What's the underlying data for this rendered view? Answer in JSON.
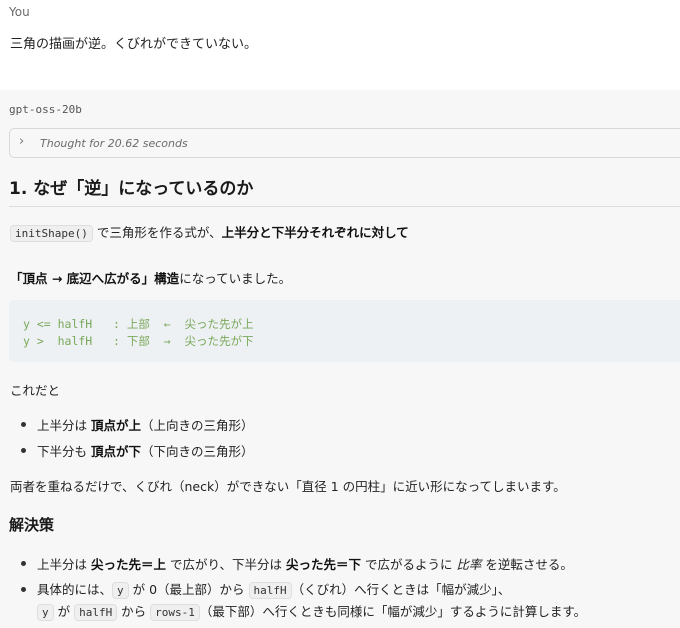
{
  "user": {
    "sender": "You",
    "message": "三角の描画が逆。くびれができていない。"
  },
  "assistant": {
    "model": "gpt-oss-20b",
    "thought_label": "Thought for 20.62 seconds",
    "heading": "1. なぜ「逆」になっているのか",
    "p1": {
      "code": "initShape()",
      "text_a": " で三角形を作る式が、",
      "bold": "上半分と下半分それぞれに対して"
    },
    "p2": {
      "bold_a": "「頂点 → 底辺へ広がる」構造",
      "text_a": "になっていました。"
    },
    "codeblock": [
      "y <= halfH   : 上部  ←  尖った先が上",
      "y >  halfH   : 下部  →  尖った先が下"
    ],
    "p3": "これだと",
    "list1": [
      {
        "a": "上半分は ",
        "b": "頂点が上",
        "c": "（上向きの三角形）"
      },
      {
        "a": "下半分も ",
        "b": "頂点が下",
        "c": "（下向きの三角形）"
      }
    ],
    "p4": "両者を重ねるだけで、くびれ（neck）ができない「直径 1 の円柱」に近い形になってしまいます。",
    "heading2": "解決策",
    "list2_item1": {
      "a": "上半分は ",
      "b1": "尖った先＝上",
      "c": " で広がり、下半分は ",
      "b2": "尖った先＝下",
      "d": " で広がるように ",
      "i": "比率",
      "e": " を逆転させる。"
    },
    "list2_item2": {
      "a": "具体的には、",
      "code_y": "y",
      "b": " が 0（最上部）から ",
      "code_halfH": "halfH",
      "c": "（くびれ）へ行くときは「幅が減少」、",
      "code_y2": "y",
      "d": " が ",
      "code_halfH2": "halfH",
      "e": " から ",
      "code_rows": "rows-1",
      "f": "（最下部）へ行くときも同様に「幅が減少」するように計算します。"
    }
  }
}
